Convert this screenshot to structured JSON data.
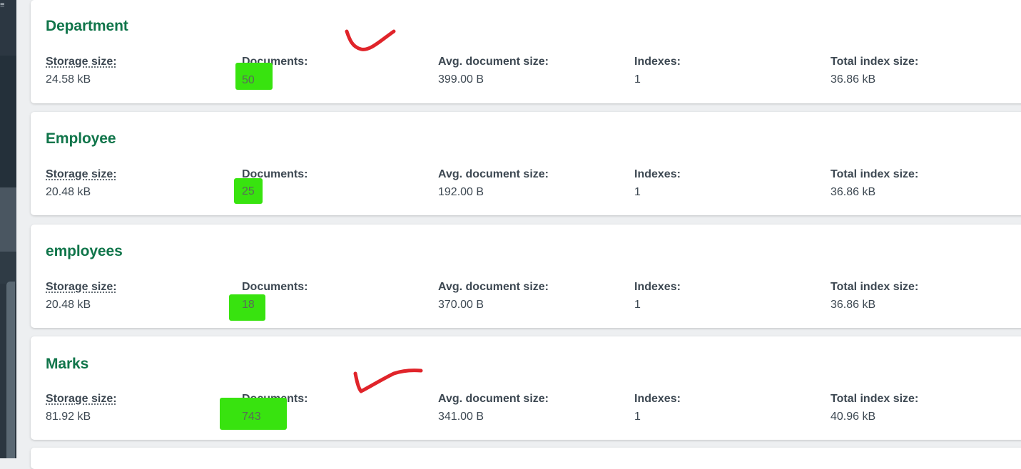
{
  "sidebar": {
    "menu_icon": "menu-icon"
  },
  "labels": {
    "storage_size": "Storage size:",
    "documents": "Documents:",
    "avg_document_size": "Avg. document size:",
    "indexes": "Indexes:",
    "total_index_size": "Total index size:"
  },
  "collections": [
    {
      "name": "Department",
      "storage_size": "24.58 kB",
      "documents": "50",
      "avg_document_size": "399.00 B",
      "indexes": "1",
      "total_index_size": "36.86 kB"
    },
    {
      "name": "Employee",
      "storage_size": "20.48 kB",
      "documents": "25",
      "avg_document_size": "192.00 B",
      "indexes": "1",
      "total_index_size": "36.86 kB"
    },
    {
      "name": "employees",
      "storage_size": "20.48 kB",
      "documents": "18",
      "avg_document_size": "370.00 B",
      "indexes": "1",
      "total_index_size": "36.86 kB"
    },
    {
      "name": "Marks",
      "storage_size": "81.92 kB",
      "documents": "743",
      "avg_document_size": "341.00 B",
      "indexes": "1",
      "total_index_size": "40.96 kB"
    }
  ],
  "annotations": {
    "highlight_color": "#38e30f",
    "checkmark_color": "#e0242a"
  }
}
